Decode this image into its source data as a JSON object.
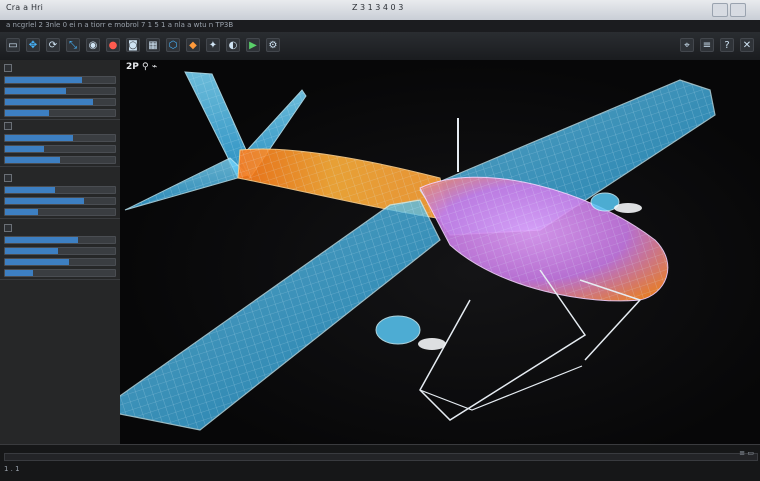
{
  "window": {
    "title": "Cra a Hri",
    "center_title": "Z 3 1 3 4 0 3",
    "strip_text": "a ncgrlel 2 3nle 0 ei n a tiorr e mobrol 7 1 5 1 a nla a wtu n TP3B"
  },
  "toolbar": {
    "buttons": [
      {
        "name": "new-file-icon",
        "glyph": "▭",
        "tone": "plain"
      },
      {
        "name": "move-icon",
        "glyph": "✥",
        "tone": "blue"
      },
      {
        "name": "rotate-icon",
        "glyph": "⟳",
        "tone": "plain"
      },
      {
        "name": "scale-icon",
        "glyph": "⤡",
        "tone": "blue"
      },
      {
        "name": "select-icon",
        "glyph": "◉",
        "tone": "plain"
      },
      {
        "name": "record-icon",
        "glyph": "●",
        "tone": "red"
      },
      {
        "name": "camera-icon",
        "glyph": "◙",
        "tone": "plain"
      },
      {
        "name": "grid-icon",
        "glyph": "▦",
        "tone": "plain"
      },
      {
        "name": "mesh-icon",
        "glyph": "⬡",
        "tone": "blue"
      },
      {
        "name": "render-icon",
        "glyph": "◆",
        "tone": "orange"
      },
      {
        "name": "light-icon",
        "glyph": "✦",
        "tone": "plain"
      },
      {
        "name": "material-icon",
        "glyph": "◐",
        "tone": "plain"
      },
      {
        "name": "play-icon",
        "glyph": "▶",
        "tone": "green"
      },
      {
        "name": "settings-icon",
        "glyph": "⚙",
        "tone": "plain"
      },
      {
        "name": "snap-icon",
        "glyph": "⌖",
        "tone": "plain"
      },
      {
        "name": "layers-icon",
        "glyph": "≡",
        "tone": "plain"
      },
      {
        "name": "help-icon",
        "glyph": "?",
        "tone": "plain"
      },
      {
        "name": "close-panel-icon",
        "glyph": "✕",
        "tone": "plain"
      }
    ]
  },
  "viewport": {
    "label": "2P ⚲ ⌁"
  },
  "status": {
    "left": "1 . 1",
    "right": "≡ ▭"
  }
}
